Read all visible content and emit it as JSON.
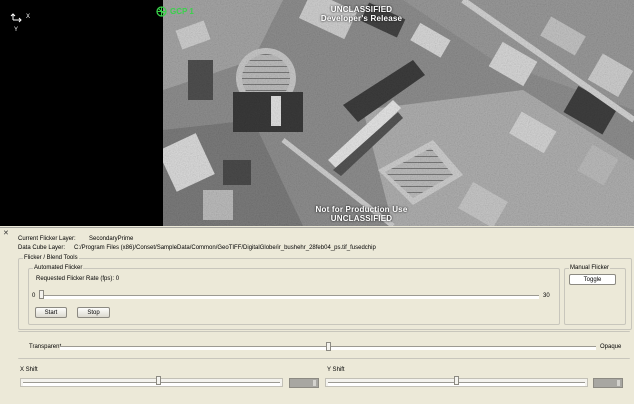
{
  "viewer": {
    "banner_top_1": "UNCLASSIFIED",
    "banner_top_2": "Developer's Release",
    "banner_bottom_1": "Not for Production Use",
    "banner_bottom_2": "UNCLASSIFIED",
    "axis_x": "X",
    "axis_y": "Y",
    "gcp_label": "GCP 1",
    "gcp_color": "#39d24a"
  },
  "info": {
    "current_layer_label": "Current Flicker Layer:",
    "current_layer_value": "SecondaryPrime",
    "data_cube_label": "Data Cube Layer:",
    "data_cube_value": "C:/Program Files (x86)/Conset/SampleData/Common/GeoTIFF/DigitalGlobe/ir_bushehr_28feb04_ps.tif_fusedchip"
  },
  "flicker": {
    "group_title": "Flicker / Blend Tools",
    "automated_title": "Automated Flicker",
    "rate_label": "Requested Flicker Rate (fps): 0",
    "slider_min": "0",
    "slider_max": "30",
    "rate_value": 0,
    "start_label": "Start",
    "stop_label": "Stop",
    "manual_title": "Manual Flicker",
    "toggle_label": "Toggle"
  },
  "blend": {
    "left_label": "Transparent",
    "right_label": "Opaque",
    "level": 0.5
  },
  "shift": {
    "x_label": "X Shift",
    "y_label": "Y Shift",
    "x_value": 0.53,
    "y_value": 0.5
  }
}
